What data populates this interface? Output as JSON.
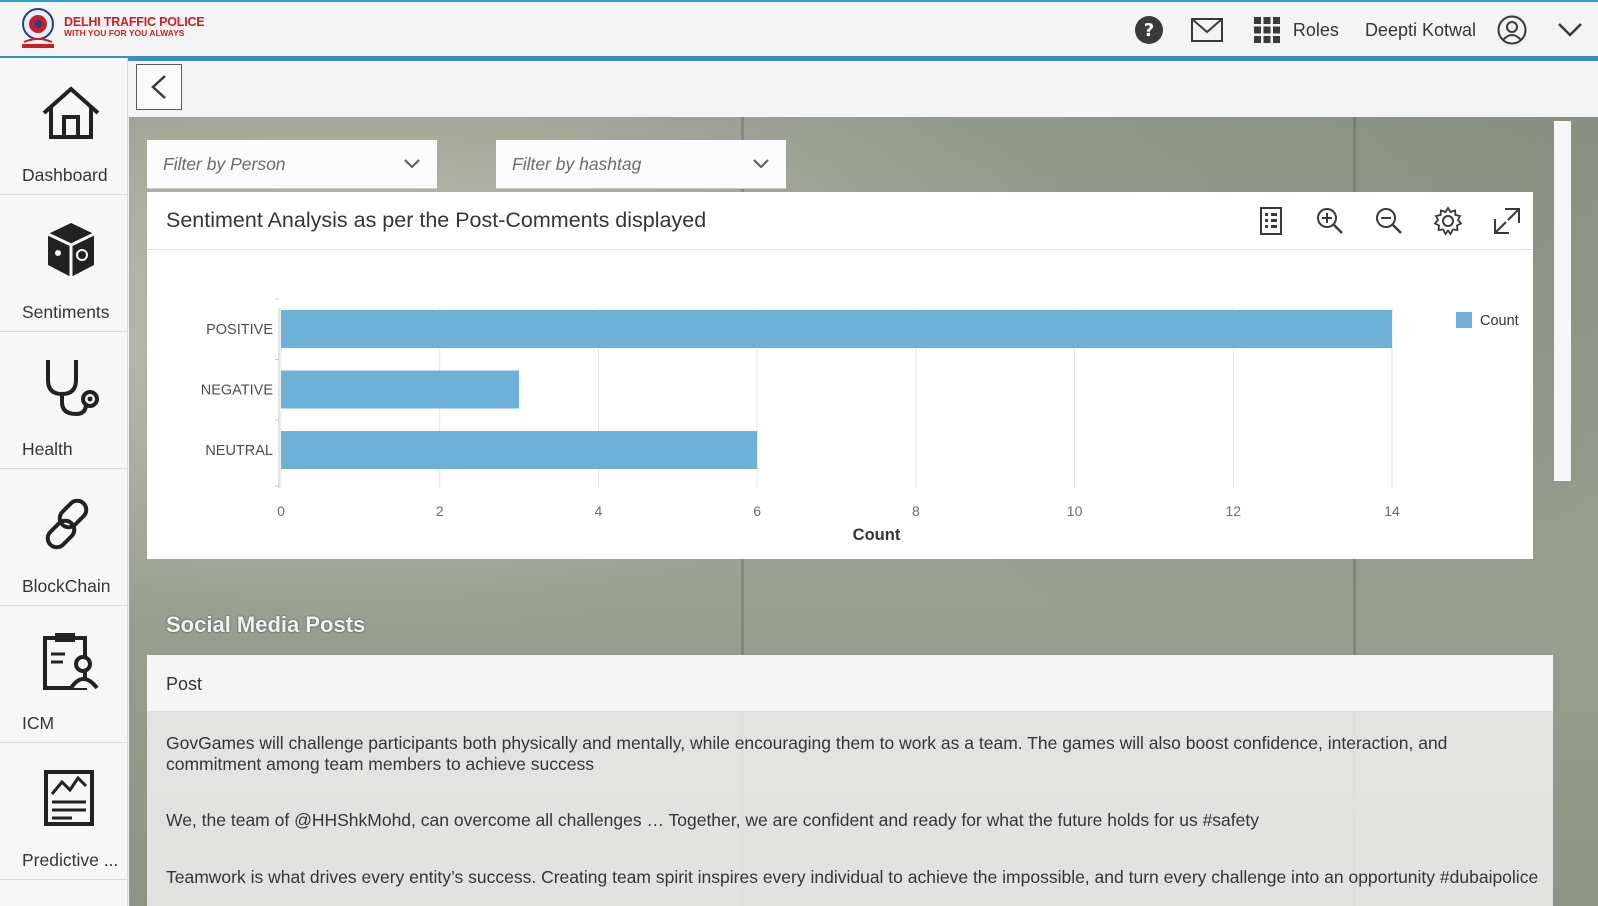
{
  "header": {
    "logo_title": "DELHI TRAFFIC POLICE",
    "logo_subtitle": "WITH YOU FOR YOU ALWAYS",
    "roles_label": "Roles",
    "user_name": "Deepti Kotwal",
    "brand_color": "#c8202a",
    "accent_color": "#3d8fc1"
  },
  "sidebar": {
    "items": [
      {
        "label": "Dashboard",
        "icon": "home-icon"
      },
      {
        "label": "Sentiments",
        "icon": "sentiments-icon"
      },
      {
        "label": "Health",
        "icon": "stethoscope-icon"
      },
      {
        "label": "BlockChain",
        "icon": "chain-link-icon"
      },
      {
        "label": "ICM",
        "icon": "clipboard-user-icon"
      },
      {
        "label": "Predictive ...",
        "icon": "report-chart-icon"
      }
    ]
  },
  "filters": {
    "person_placeholder": "Filter by Person",
    "hashtag_placeholder": "Filter by hashtag"
  },
  "chart_panel": {
    "title": "Sentiment Analysis as per the Post-Comments displayed",
    "tools": [
      "legend-icon",
      "zoom-in-icon",
      "zoom-out-icon",
      "settings-icon",
      "fullscreen-icon"
    ]
  },
  "chart_data": {
    "type": "bar",
    "orientation": "horizontal",
    "categories": [
      "POSITIVE",
      "NEGATIVE",
      "NEUTRAL"
    ],
    "series": [
      {
        "name": "Count",
        "values": [
          14,
          3,
          6
        ],
        "color": "#6db0d8"
      }
    ],
    "xlabel": "Count",
    "ylabel": "",
    "xlim": [
      0,
      14
    ],
    "xticks": [
      0,
      2,
      4,
      6,
      8,
      10,
      12,
      14
    ],
    "grid": true,
    "legend": "top-right"
  },
  "posts": {
    "section_title": "Social Media Posts",
    "column_header": "Post",
    "rows": [
      "GovGames will challenge participants both physically and mentally, while encouraging them to work as a team. The games will also boost confidence, interaction, and commitment among team members to achieve success",
      "We, the team of @HHShkMohd, can overcome all challenges … Together, we are confident and ready for what the future holds for us #safety",
      "Teamwork is what drives every entity’s success. Creating team spirit inspires every individual to achieve the impossible, and turn every challenge into an opportunity #dubaipolice"
    ]
  }
}
